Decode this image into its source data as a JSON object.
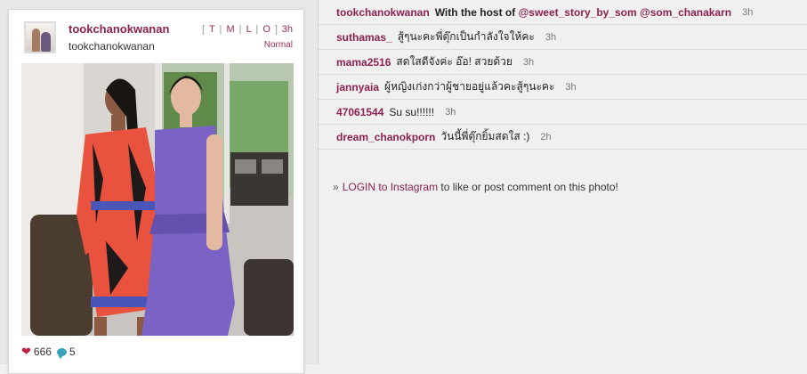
{
  "post": {
    "username": "tookchanokwanan",
    "full_name": "tookchanokwanan",
    "view_links": [
      "T",
      "M",
      "L",
      "O"
    ],
    "time_ago": "3h",
    "filter": "Normal",
    "likes": "666",
    "comments_count": "5"
  },
  "comments": [
    {
      "user": "tookchanokwanan",
      "text": "With the host of",
      "mentions": [
        "@sweet_story_by_som",
        "@som_chanakarn"
      ],
      "time": "3h",
      "bold": true
    },
    {
      "user": "suthamas_",
      "text": "สู้ๆนะคะพี่ตุ๊กเป็นกำลังใจให้คะ",
      "time": "3h"
    },
    {
      "user": "mama2516",
      "text": "สดใสดีจังค่ะ อ๊อ! สวยด้วย",
      "time": "3h"
    },
    {
      "user": "jannyaia",
      "text": "ผู้หญิงเก่งกว่าผู้ชายอยู่แล้วคะสู้ๆนะคะ",
      "time": "3h"
    },
    {
      "user": "47061544",
      "text": "Su su!!!!!!",
      "time": "3h"
    },
    {
      "user": "dream_chanokporn",
      "text": "วันนี้พี่ตุ๊กยิ้มสดใส :)",
      "time": "2h"
    }
  ],
  "login": {
    "prefix": "»",
    "link_text": "LOGIN to Instagram",
    "suffix": "to like or post comment on this photo!"
  },
  "icons": {
    "likes": "heart-icon",
    "comments": "comment-bubble-icon"
  },
  "colors": {
    "accent": "#8b2250",
    "heart": "#c0203c",
    "bubble": "#3aa3b9"
  }
}
